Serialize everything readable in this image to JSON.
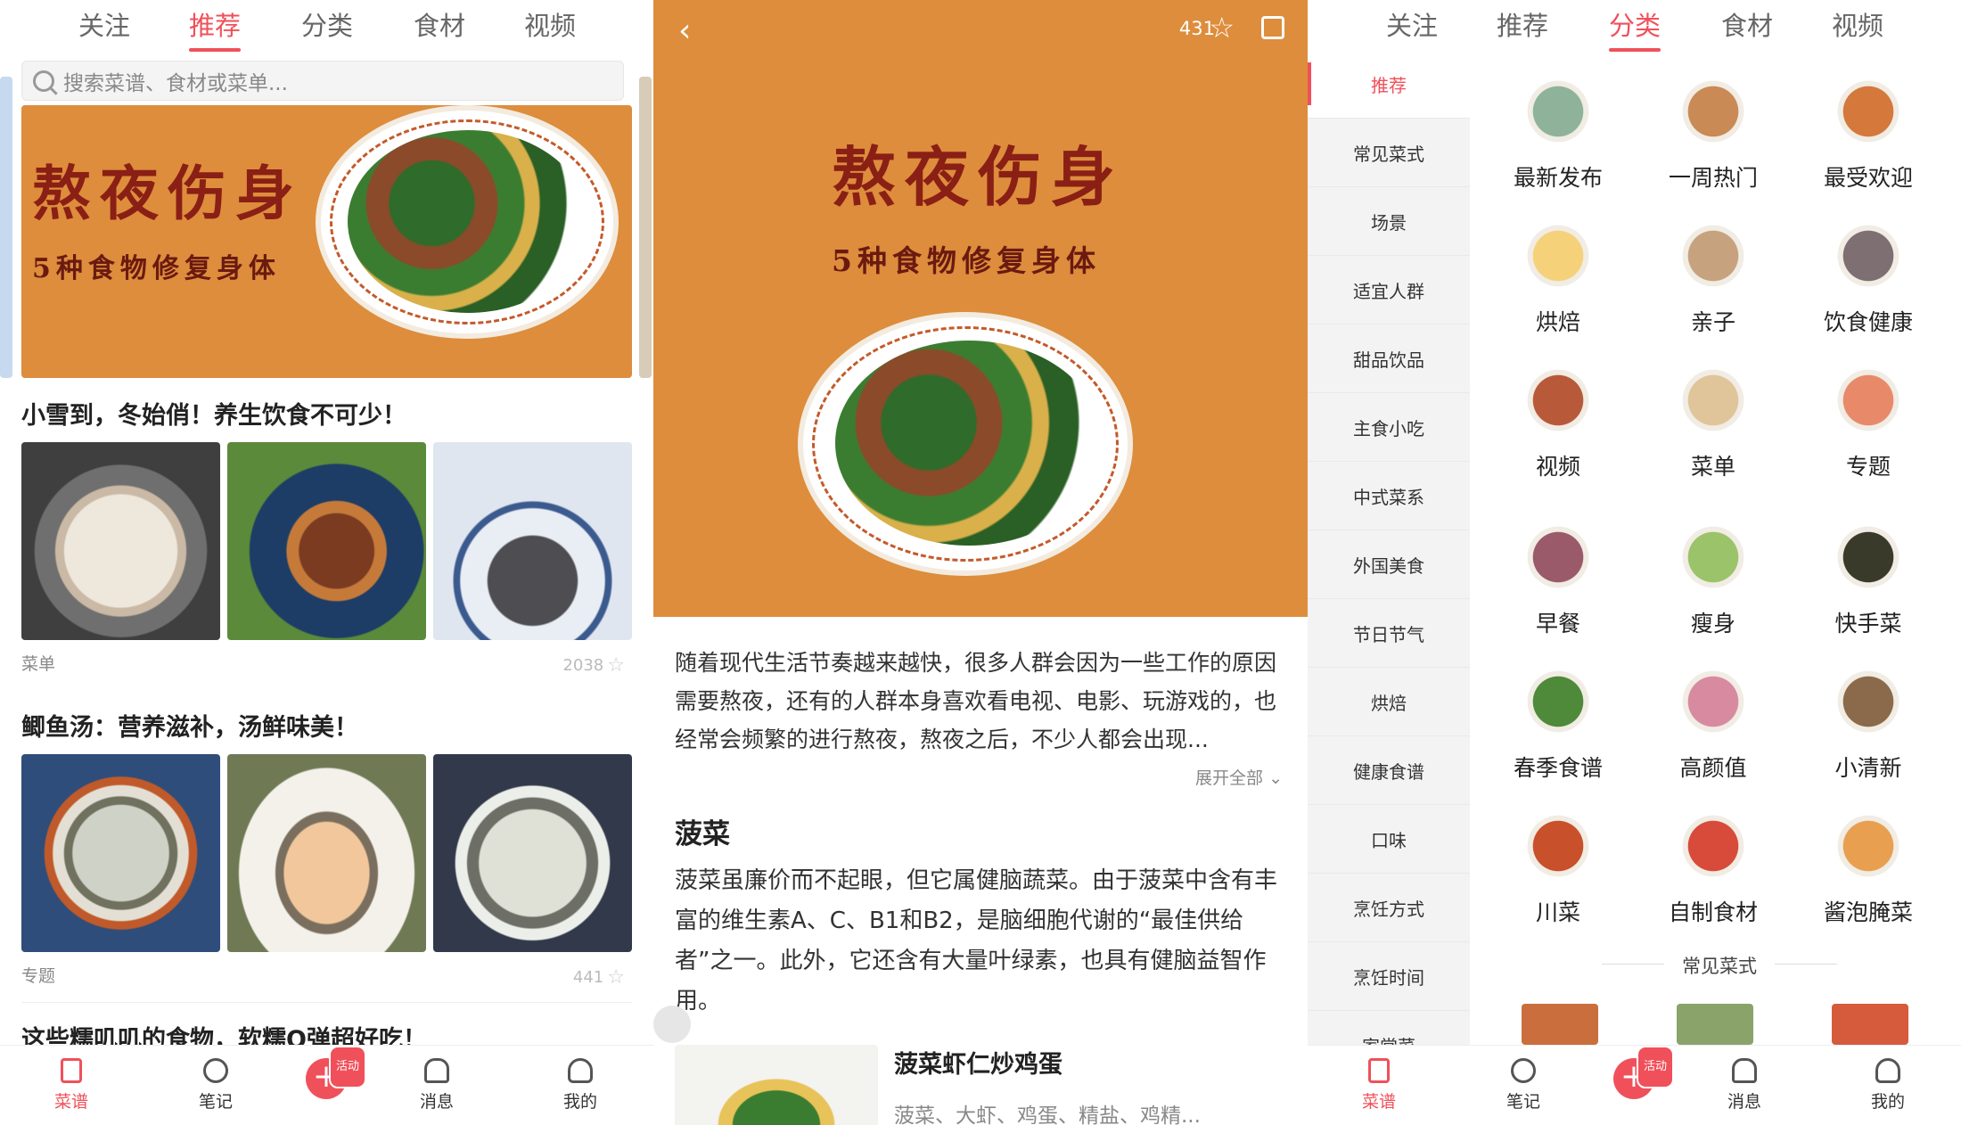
{
  "panel1": {
    "tabs": [
      "关注",
      "推荐",
      "分类",
      "食材",
      "视频"
    ],
    "active_tab": "推荐",
    "search_placeholder": "搜索菜谱、食材或菜单...",
    "banner": {
      "title": "熬夜伤身",
      "subtitle": "5种食物修复身体"
    },
    "sections": [
      {
        "title": "小雪到，冬始俏！养生饮食不可少！",
        "tag": "菜单",
        "count": "2038"
      },
      {
        "title": "鲫鱼汤：营养滋补，汤鲜味美！",
        "tag": "专题",
        "count": "441"
      },
      {
        "title": "这些糯叽叽的食物，软糯Q弹超好吃！"
      }
    ]
  },
  "panel2": {
    "like_count": "431",
    "hero": {
      "title": "熬夜伤身",
      "subtitle": "5种食物修复身体"
    },
    "intro": "随着现代生活节奏越来越快，很多人群会因为一些工作的原因需要熬夜，还有的人群本身喜欢看电视、电影、玩游戏的，也经常会频繁的进行熬夜，熬夜之后，不少人都会出现...",
    "expand_label": "展开全部",
    "section_heading": "菠菜",
    "section_body": "菠菜虽廉价而不起眼，但它属健脑蔬菜。由于菠菜中含有丰富的维生素A、C、B1和B2，是脑细胞代谢的“最佳供给者”之一。此外，它还含有大量叶绿素，也具有健脑益智作用。",
    "recipe": {
      "title": "菠菜虾仁炒鸡蛋",
      "ingredients": "菠菜、大虾、鸡蛋、精盐、鸡精..."
    }
  },
  "panel3": {
    "tabs": [
      "关注",
      "推荐",
      "分类",
      "食材",
      "视频"
    ],
    "active_tab": "分类",
    "sidebar": [
      "推荐",
      "常见菜式",
      "场景",
      "适宜人群",
      "甜品饮品",
      "主食小吃",
      "中式菜系",
      "外国美食",
      "节日节气",
      "烘焙",
      "健康食谱",
      "口味",
      "烹饪方式",
      "烹饪时间",
      "家常菜"
    ],
    "active_sidebar": "推荐",
    "categories": [
      "最新发布",
      "一周热门",
      "最受欢迎",
      "烘焙",
      "亲子",
      "饮食健康",
      "视频",
      "菜单",
      "专题",
      "早餐",
      "瘦身",
      "快手菜",
      "春季食谱",
      "高颜值",
      "小清新",
      "川菜",
      "自制食材",
      "酱泡腌菜"
    ],
    "divider_label": "常见菜式"
  },
  "bottom_nav": {
    "items": [
      "菜谱",
      "笔记",
      "消息",
      "我的"
    ],
    "plus_badge": "活动"
  },
  "colors": {
    "accent": "#f0505a",
    "banner": "#dd8d3c",
    "title_red": "#8a1f15"
  }
}
